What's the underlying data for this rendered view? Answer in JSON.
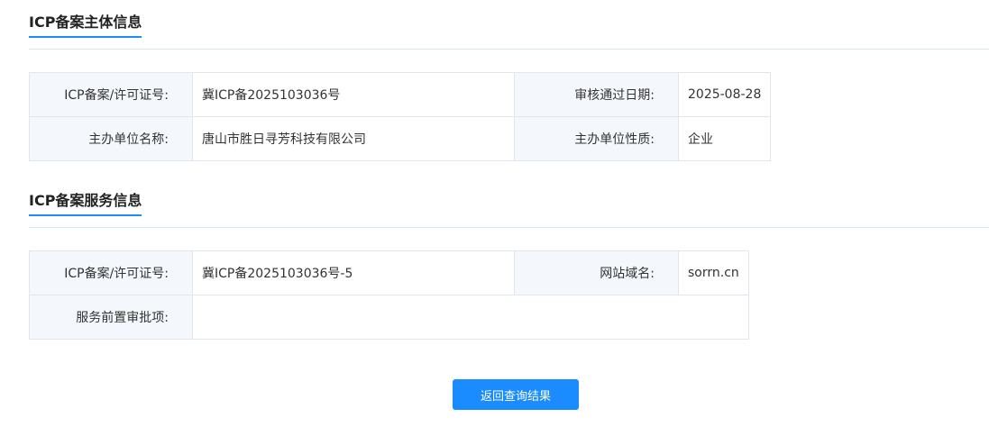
{
  "subject_section": {
    "title": "ICP备案主体信息",
    "rows": [
      {
        "label1": "ICP备案/许可证号:",
        "value1": "冀ICP备2025103036号",
        "label2": "审核通过日期:",
        "value2": "2025-08-28"
      },
      {
        "label1": "主办单位名称:",
        "value1": "唐山市胜日寻芳科技有限公司",
        "label2": "主办单位性质:",
        "value2": "企业"
      }
    ]
  },
  "service_section": {
    "title": "ICP备案服务信息",
    "rows": [
      {
        "label1": "ICP备案/许可证号:",
        "value1": "冀ICP备2025103036号-5",
        "label2": "网站域名:",
        "value2": "sorrn.cn"
      },
      {
        "label1": "服务前置审批项:",
        "value1": ""
      }
    ]
  },
  "actions": {
    "return_label": "返回查询结果"
  },
  "colors": {
    "accent": "#1a8cff",
    "label_bg": "#f4f8fc",
    "border": "#dfe6ee"
  }
}
